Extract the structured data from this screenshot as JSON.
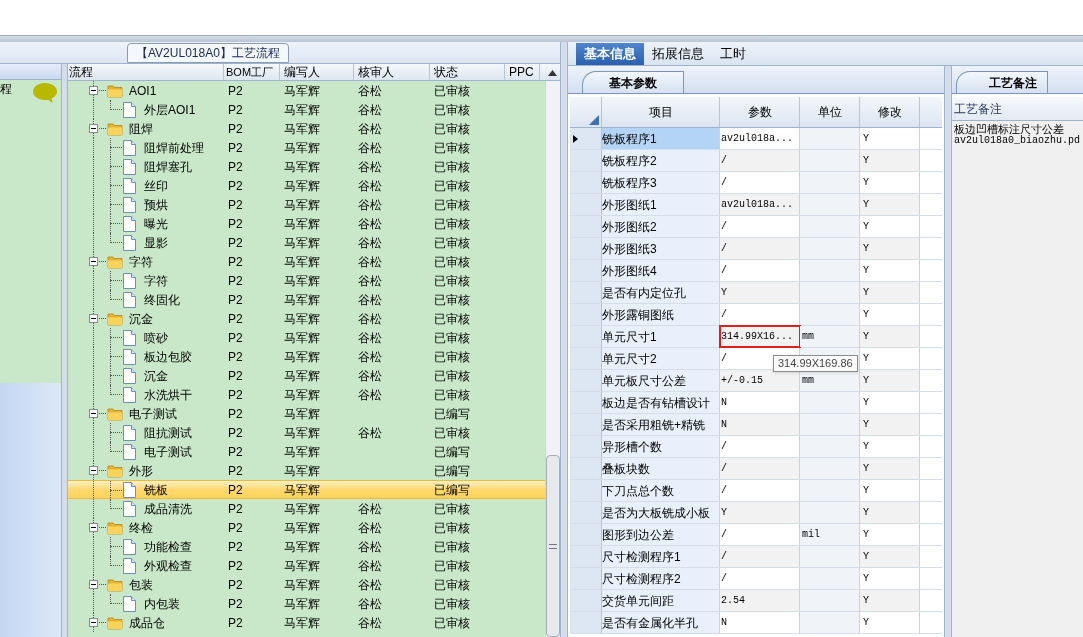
{
  "process_title": "【AV2UL018A0】工艺流程",
  "left_panel": {
    "label": "程"
  },
  "process_tree": {
    "columns": [
      "流程",
      "BOM工厂",
      "编写人",
      "核审人",
      "状态",
      "PPC"
    ],
    "rows": [
      {
        "name": "AOI1",
        "kind": "folder",
        "expanded": true,
        "selected": false,
        "bom": "P2",
        "writer": "马军辉",
        "reviewer": "谷松",
        "status": "已审核",
        "children": [
          {
            "name": "外层AOI1",
            "kind": "step",
            "selected": false,
            "bom": "P2",
            "writer": "马军辉",
            "reviewer": "谷松",
            "status": "已审核"
          }
        ]
      },
      {
        "name": "阻焊",
        "kind": "folder",
        "expanded": true,
        "selected": false,
        "bom": "P2",
        "writer": "马军辉",
        "reviewer": "谷松",
        "status": "已审核",
        "children": [
          {
            "name": "阻焊前处理",
            "kind": "step",
            "selected": false,
            "bom": "P2",
            "writer": "马军辉",
            "reviewer": "谷松",
            "status": "已审核"
          },
          {
            "name": "阻焊塞孔",
            "kind": "step",
            "selected": false,
            "bom": "P2",
            "writer": "马军辉",
            "reviewer": "谷松",
            "status": "已审核"
          },
          {
            "name": "丝印",
            "kind": "step",
            "selected": false,
            "bom": "P2",
            "writer": "马军辉",
            "reviewer": "谷松",
            "status": "已审核"
          },
          {
            "name": "预烘",
            "kind": "step",
            "selected": false,
            "bom": "P2",
            "writer": "马军辉",
            "reviewer": "谷松",
            "status": "已审核"
          },
          {
            "name": "曝光",
            "kind": "step",
            "selected": false,
            "bom": "P2",
            "writer": "马军辉",
            "reviewer": "谷松",
            "status": "已审核"
          },
          {
            "name": "显影",
            "kind": "step",
            "selected": false,
            "bom": "P2",
            "writer": "马军辉",
            "reviewer": "谷松",
            "status": "已审核"
          }
        ]
      },
      {
        "name": "字符",
        "kind": "folder",
        "expanded": true,
        "selected": false,
        "bom": "P2",
        "writer": "马军辉",
        "reviewer": "谷松",
        "status": "已审核",
        "children": [
          {
            "name": "字符",
            "kind": "step",
            "selected": false,
            "bom": "P2",
            "writer": "马军辉",
            "reviewer": "谷松",
            "status": "已审核"
          },
          {
            "name": "终固化",
            "kind": "step",
            "selected": false,
            "bom": "P2",
            "writer": "马军辉",
            "reviewer": "谷松",
            "status": "已审核"
          }
        ]
      },
      {
        "name": "沉金",
        "kind": "folder",
        "expanded": true,
        "selected": false,
        "bom": "P2",
        "writer": "马军辉",
        "reviewer": "谷松",
        "status": "已审核",
        "children": [
          {
            "name": "喷砂",
            "kind": "step",
            "selected": false,
            "bom": "P2",
            "writer": "马军辉",
            "reviewer": "谷松",
            "status": "已审核"
          },
          {
            "name": "板边包胶",
            "kind": "step",
            "selected": false,
            "bom": "P2",
            "writer": "马军辉",
            "reviewer": "谷松",
            "status": "已审核"
          },
          {
            "name": "沉金",
            "kind": "step",
            "selected": false,
            "bom": "P2",
            "writer": "马军辉",
            "reviewer": "谷松",
            "status": "已审核"
          },
          {
            "name": "水洗烘干",
            "kind": "step",
            "selected": false,
            "bom": "P2",
            "writer": "马军辉",
            "reviewer": "谷松",
            "status": "已审核"
          }
        ]
      },
      {
        "name": "电子测试",
        "kind": "folder",
        "expanded": true,
        "selected": false,
        "bom": "P2",
        "writer": "马军辉",
        "status": "已编写",
        "children": [
          {
            "name": "阻抗测试",
            "kind": "step",
            "selected": false,
            "bom": "P2",
            "writer": "马军辉",
            "reviewer": "谷松",
            "status": "已审核"
          },
          {
            "name": "电子测试",
            "kind": "step",
            "selected": false,
            "bom": "P2",
            "writer": "马军辉",
            "status": "已编写"
          }
        ]
      },
      {
        "name": "外形",
        "kind": "folder",
        "expanded": true,
        "selected": false,
        "bom": "P2",
        "writer": "马军辉",
        "status": "已编写",
        "children": [
          {
            "name": "铣板",
            "kind": "step",
            "selected": true,
            "bom": "P2",
            "writer": "马军辉",
            "status": "已编写"
          },
          {
            "name": "成品清洗",
            "kind": "step",
            "selected": false,
            "bom": "P2",
            "writer": "马军辉",
            "reviewer": "谷松",
            "status": "已审核"
          }
        ]
      },
      {
        "name": "终检",
        "kind": "folder",
        "expanded": true,
        "selected": false,
        "bom": "P2",
        "writer": "马军辉",
        "reviewer": "谷松",
        "status": "已审核",
        "children": [
          {
            "name": "功能检查",
            "kind": "step",
            "selected": false,
            "bom": "P2",
            "writer": "马军辉",
            "reviewer": "谷松",
            "status": "已审核"
          },
          {
            "name": "外观检查",
            "kind": "step",
            "selected": false,
            "bom": "P2",
            "writer": "马军辉",
            "reviewer": "谷松",
            "status": "已审核"
          }
        ]
      },
      {
        "name": "包装",
        "kind": "folder",
        "expanded": true,
        "selected": false,
        "bom": "P2",
        "writer": "马军辉",
        "reviewer": "谷松",
        "status": "已审核",
        "children": [
          {
            "name": "内包装",
            "kind": "step",
            "selected": false,
            "bom": "P2",
            "writer": "马军辉",
            "reviewer": "谷松",
            "status": "已审核"
          }
        ]
      },
      {
        "name": "成品仓",
        "kind": "folder",
        "expanded": true,
        "selected": false,
        "bom": "P2",
        "writer": "马军辉",
        "reviewer": "谷松",
        "status": "已审核"
      }
    ]
  },
  "tabs": [
    {
      "label": "基本信息",
      "selected": true
    },
    {
      "label": "拓展信息",
      "selected": false
    },
    {
      "label": "工时",
      "selected": false
    }
  ],
  "sub_tab": {
    "label": "基本参数"
  },
  "params": {
    "columns": [
      "项目",
      "参数",
      "单位",
      "修改"
    ],
    "rows": [
      {
        "item": "铣板程序1",
        "value": "av2ul018a...",
        "modified": "Y",
        "selected": true,
        "highlighted": false
      },
      {
        "item": "铣板程序2",
        "value": "/",
        "modified": "Y",
        "selected": false,
        "highlighted": false
      },
      {
        "item": "铣板程序3",
        "value": "/",
        "modified": "Y",
        "selected": false,
        "highlighted": false
      },
      {
        "item": "外形图纸1",
        "value": "av2ul018a...",
        "modified": "Y",
        "selected": false,
        "highlighted": false
      },
      {
        "item": "外形图纸2",
        "value": "/",
        "modified": "Y",
        "selected": false,
        "highlighted": false
      },
      {
        "item": "外形图纸3",
        "value": "/",
        "modified": "Y",
        "selected": false,
        "highlighted": false
      },
      {
        "item": "外形图纸4",
        "value": "/",
        "modified": "Y",
        "selected": false,
        "highlighted": false
      },
      {
        "item": "是否有内定位孔",
        "value": "Y",
        "modified": "Y",
        "selected": false,
        "highlighted": false
      },
      {
        "item": "外形露铜图纸",
        "value": "/",
        "modified": "Y",
        "selected": false,
        "highlighted": false
      },
      {
        "item": "单元尺寸1",
        "value": "314.99X16...",
        "unit": "mm",
        "modified": "Y",
        "selected": false,
        "highlighted": true
      },
      {
        "item": "单元尺寸2",
        "value": "/",
        "modified": "Y",
        "selected": false,
        "highlighted": false
      },
      {
        "item": "单元板尺寸公差",
        "value": "+/-0.15",
        "unit": "mm",
        "modified": "Y",
        "selected": false,
        "highlighted": false
      },
      {
        "item": "板边是否有钻槽设计",
        "value": "N",
        "modified": "Y",
        "selected": false,
        "highlighted": false
      },
      {
        "item": "是否采用粗铣+精铣",
        "value": "N",
        "modified": "Y",
        "selected": false,
        "highlighted": false
      },
      {
        "item": "异形槽个数",
        "value": "/",
        "modified": "Y",
        "selected": false,
        "highlighted": false
      },
      {
        "item": "叠板块数",
        "value": "/",
        "modified": "Y",
        "selected": false,
        "highlighted": false
      },
      {
        "item": "下刀点总个数",
        "value": "/",
        "modified": "Y",
        "selected": false,
        "highlighted": false
      },
      {
        "item": "是否为大板铣成小板",
        "value": "Y",
        "modified": "Y",
        "selected": false,
        "highlighted": false
      },
      {
        "item": "图形到边公差",
        "value": "/",
        "unit": "mil",
        "modified": "Y",
        "selected": false,
        "highlighted": false
      },
      {
        "item": "尺寸检测程序1",
        "value": "/",
        "modified": "Y",
        "selected": false,
        "highlighted": false
      },
      {
        "item": "尺寸检测程序2",
        "value": "/",
        "modified": "Y",
        "selected": false,
        "highlighted": false
      },
      {
        "item": "交货单元间距",
        "value": "2.54",
        "modified": "Y",
        "selected": false,
        "highlighted": false
      },
      {
        "item": "是否有金属化半孔",
        "value": "N",
        "modified": "Y",
        "selected": false,
        "highlighted": false
      }
    ]
  },
  "tooltip": "314.99X169.86",
  "notes": {
    "tab": "工艺备注",
    "header": "工艺备注",
    "lines": [
      "板边凹槽标注尺寸公差",
      "av2ul018a0_biaozhu.pd"
    ]
  }
}
